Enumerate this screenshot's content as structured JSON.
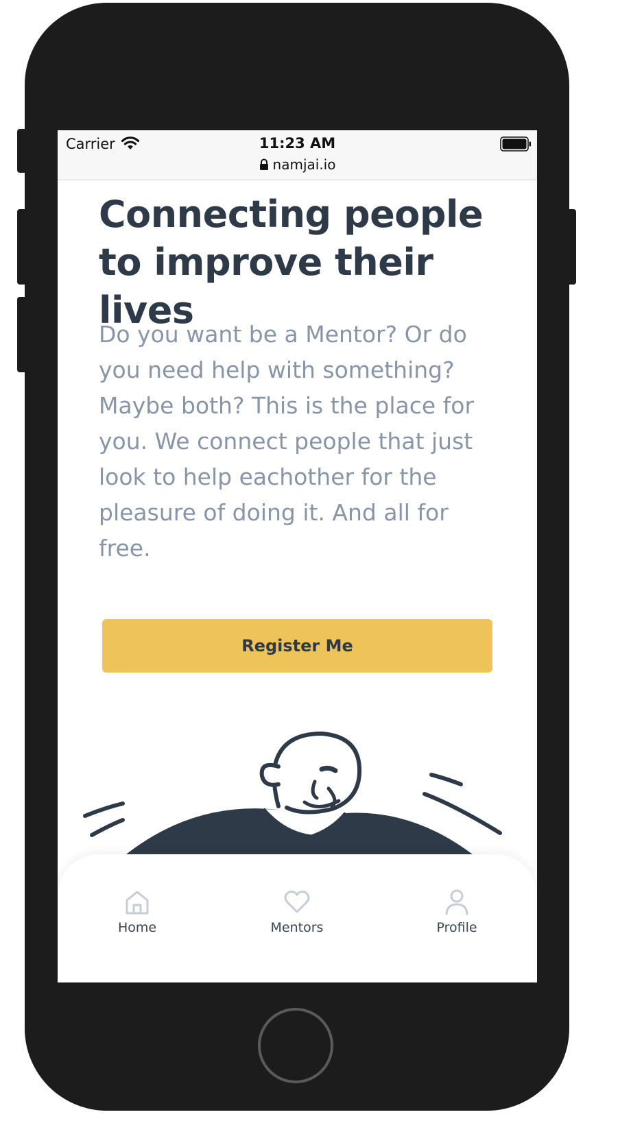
{
  "status_bar": {
    "carrier": "Carrier",
    "time": "11:23 AM",
    "url": "namjai.io"
  },
  "hero": {
    "headline_line1": "Connecting people",
    "headline_line2": "to improve their lives",
    "description": "Do you want be a Mentor? Or do you need help with something? Maybe both? This is the place for you. We connect people that just look to help eachother for the pleasure of doing it. And all for free.",
    "cta_label": "Register Me"
  },
  "tabbar": {
    "items": [
      {
        "label": "Home",
        "icon": "home-icon"
      },
      {
        "label": "Mentors",
        "icon": "heart-icon"
      },
      {
        "label": "Profile",
        "icon": "user-icon"
      }
    ]
  },
  "colors": {
    "accent": "#eec35a",
    "heading": "#2f3a48",
    "body_text": "#8895a6",
    "device": "#1c1c1c"
  }
}
